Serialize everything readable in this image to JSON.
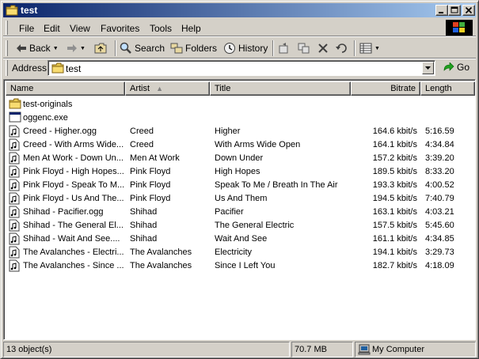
{
  "window": {
    "title": "test"
  },
  "menu": [
    "File",
    "Edit",
    "View",
    "Favorites",
    "Tools",
    "Help"
  ],
  "toolbar": {
    "back_label": "Back",
    "search_label": "Search",
    "folders_label": "Folders",
    "history_label": "History"
  },
  "address": {
    "label": "Address",
    "value": "test",
    "go_label": "Go"
  },
  "columns": {
    "name": "Name",
    "artist": "Artist",
    "title": "Title",
    "bitrate": "Bitrate",
    "length": "Length"
  },
  "files": [
    {
      "icon": "folder-icon",
      "name": "test-originals",
      "artist": "",
      "title": "",
      "bitrate": "",
      "length": ""
    },
    {
      "icon": "exe-icon",
      "name": "oggenc.exe",
      "artist": "",
      "title": "",
      "bitrate": "",
      "length": ""
    },
    {
      "icon": "audio-file-icon",
      "name": "Creed - Higher.ogg",
      "artist": "Creed",
      "title": "Higher",
      "bitrate": "164.6 kbit/s",
      "length": "5:16.59"
    },
    {
      "icon": "audio-file-icon",
      "name": "Creed - With Arms Wide...",
      "artist": "Creed",
      "title": "With Arms Wide Open",
      "bitrate": "164.1 kbit/s",
      "length": "4:34.84"
    },
    {
      "icon": "audio-file-icon",
      "name": "Men At Work - Down Un...",
      "artist": "Men At Work",
      "title": "Down Under",
      "bitrate": "157.2 kbit/s",
      "length": "3:39.20"
    },
    {
      "icon": "audio-file-icon",
      "name": "Pink Floyd - High Hopes....",
      "artist": "Pink Floyd",
      "title": "High Hopes",
      "bitrate": "189.5 kbit/s",
      "length": "8:33.20"
    },
    {
      "icon": "audio-file-icon",
      "name": "Pink Floyd - Speak To M...",
      "artist": "Pink Floyd",
      "title": "Speak To Me / Breath In The Air",
      "bitrate": "193.3 kbit/s",
      "length": "4:00.52"
    },
    {
      "icon": "audio-file-icon",
      "name": "Pink Floyd - Us And The...",
      "artist": "Pink Floyd",
      "title": "Us And Them",
      "bitrate": "194.5 kbit/s",
      "length": "7:40.79"
    },
    {
      "icon": "audio-file-icon",
      "name": "Shihad - Pacifier.ogg",
      "artist": "Shihad",
      "title": "Pacifier",
      "bitrate": "163.1 kbit/s",
      "length": "4:03.21"
    },
    {
      "icon": "audio-file-icon",
      "name": "Shihad - The General El...",
      "artist": "Shihad",
      "title": "The General Electric",
      "bitrate": "157.5 kbit/s",
      "length": "5:45.60"
    },
    {
      "icon": "audio-file-icon",
      "name": "Shihad - Wait And See....",
      "artist": "Shihad",
      "title": "Wait And See",
      "bitrate": "161.1 kbit/s",
      "length": "4:34.85"
    },
    {
      "icon": "audio-file-icon",
      "name": "The Avalanches - Electri...",
      "artist": "The Avalanches",
      "title": "Electricity",
      "bitrate": "194.1 kbit/s",
      "length": "3:29.73"
    },
    {
      "icon": "audio-file-icon",
      "name": "The Avalanches - Since ...",
      "artist": "The Avalanches",
      "title": "Since I Left You",
      "bitrate": "182.7 kbit/s",
      "length": "4:18.09"
    }
  ],
  "status": {
    "count": "13 object(s)",
    "size": "70.7 MB",
    "zone": "My Computer"
  }
}
